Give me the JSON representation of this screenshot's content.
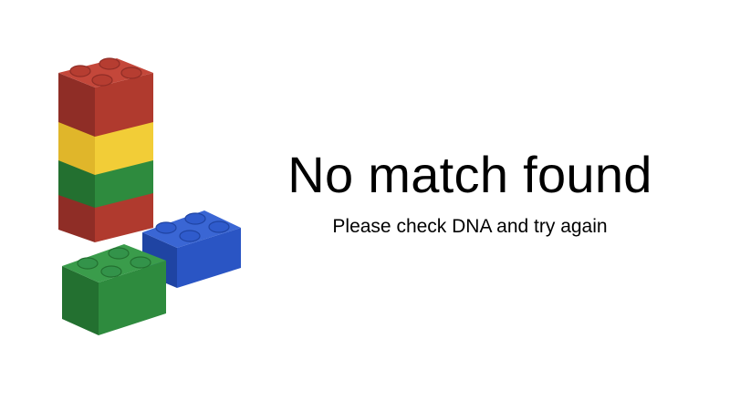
{
  "message": {
    "title": "No match found",
    "subtitle": "Please check DNA and try again"
  },
  "illustration": {
    "icon": "lego-bricks-icon",
    "colors": {
      "red": "#b03a2e",
      "yellow": "#f2cd37",
      "green": "#2e8b3e",
      "blue": "#2a55c4"
    }
  }
}
